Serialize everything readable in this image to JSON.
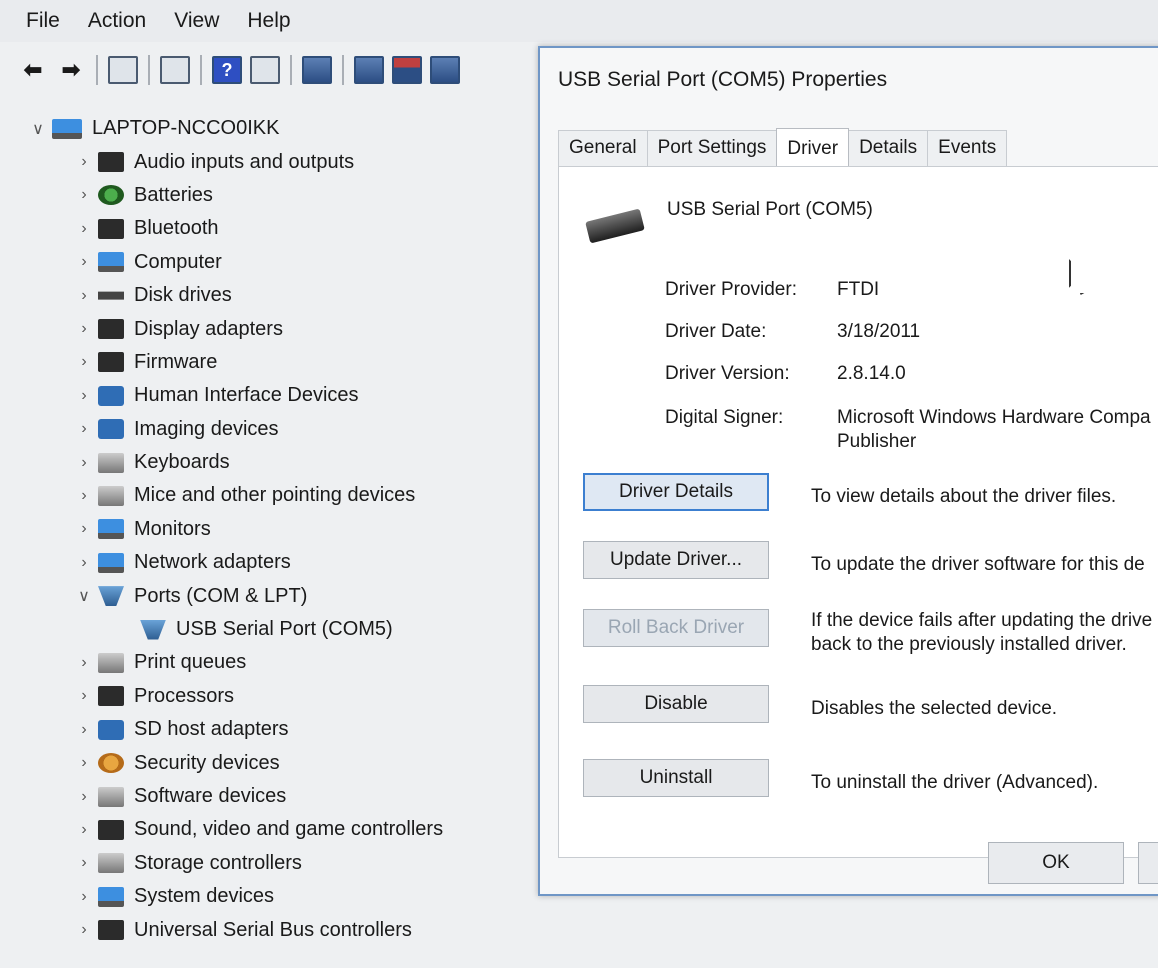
{
  "menubar": {
    "items": [
      "File",
      "Action",
      "View",
      "Help"
    ]
  },
  "tree": {
    "root": "LAPTOP-NCCO0IKK",
    "items": [
      {
        "label": "Audio inputs and outputs",
        "icon": "speaker-icon"
      },
      {
        "label": "Batteries",
        "icon": "battery-icon"
      },
      {
        "label": "Bluetooth",
        "icon": "bluetooth-icon"
      },
      {
        "label": "Computer",
        "icon": "computer-icon"
      },
      {
        "label": "Disk drives",
        "icon": "disk-icon"
      },
      {
        "label": "Display adapters",
        "icon": "display-adapter-icon"
      },
      {
        "label": "Firmware",
        "icon": "firmware-icon"
      },
      {
        "label": "Human Interface Devices",
        "icon": "hid-icon"
      },
      {
        "label": "Imaging devices",
        "icon": "camera-icon"
      },
      {
        "label": "Keyboards",
        "icon": "keyboard-icon"
      },
      {
        "label": "Mice and other pointing devices",
        "icon": "mouse-icon"
      },
      {
        "label": "Monitors",
        "icon": "monitor-icon"
      },
      {
        "label": "Network adapters",
        "icon": "network-icon"
      },
      {
        "label": "Ports (COM & LPT)",
        "icon": "port-icon"
      },
      {
        "label": "USB Serial Port (COM5)",
        "icon": "port-icon"
      },
      {
        "label": "Print queues",
        "icon": "printer-icon"
      },
      {
        "label": "Processors",
        "icon": "processor-icon"
      },
      {
        "label": "SD host adapters",
        "icon": "sd-icon"
      },
      {
        "label": "Security devices",
        "icon": "security-icon"
      },
      {
        "label": "Software devices",
        "icon": "software-icon"
      },
      {
        "label": "Sound, video and game controllers",
        "icon": "sound-icon"
      },
      {
        "label": "Storage controllers",
        "icon": "storage-icon"
      },
      {
        "label": "System devices",
        "icon": "system-icon"
      },
      {
        "label": "Universal Serial Bus controllers",
        "icon": "usb-icon"
      }
    ]
  },
  "dialog": {
    "title": "USB Serial Port (COM5) Properties",
    "tabs": [
      "General",
      "Port Settings",
      "Driver",
      "Details",
      "Events"
    ],
    "active_tab": "Driver",
    "device_name": "USB Serial Port (COM5)",
    "props": [
      {
        "label": "Driver Provider:",
        "value": "FTDI"
      },
      {
        "label": "Driver Date:",
        "value": "3/18/2011"
      },
      {
        "label": "Driver Version:",
        "value": "2.8.14.0"
      },
      {
        "label": "Digital Signer:",
        "value": "Microsoft Windows Hardware Compa"
      }
    ],
    "signer_line2": "Publisher",
    "buttons": [
      {
        "label": "Driver Details",
        "desc": "To view details about the driver files."
      },
      {
        "label": "Update Driver...",
        "desc": "To update the driver software for this de"
      },
      {
        "label": "Roll Back Driver",
        "desc": "If the device fails after updating the drive",
        "desc2": "back to the previously installed driver."
      },
      {
        "label": "Disable",
        "desc": "Disables the selected device."
      },
      {
        "label": "Uninstall",
        "desc": "To uninstall the driver (Advanced)."
      }
    ],
    "ok": "OK"
  },
  "colors": {
    "accent": "#3c7fd0",
    "dialog_border": "#6f96c6"
  }
}
